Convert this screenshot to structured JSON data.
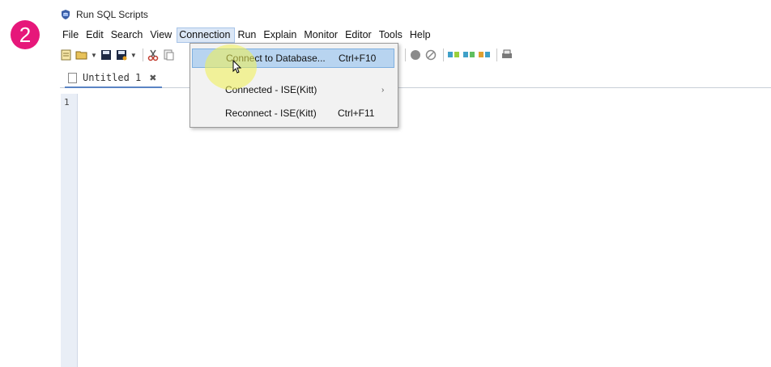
{
  "step": {
    "number": "2",
    "color": "#e6177a"
  },
  "window": {
    "title": "Run SQL Scripts",
    "icon": "database-shield-icon"
  },
  "menubar": {
    "items": [
      {
        "label": "File"
      },
      {
        "label": "Edit"
      },
      {
        "label": "Search"
      },
      {
        "label": "View"
      },
      {
        "label": "Connection",
        "active": true
      },
      {
        "label": "Run"
      },
      {
        "label": "Explain"
      },
      {
        "label": "Monitor"
      },
      {
        "label": "Editor"
      },
      {
        "label": "Tools"
      },
      {
        "label": "Help"
      }
    ]
  },
  "toolbar": {
    "icons": [
      "new-script-icon",
      "open-folder-icon",
      "save-icon",
      "save-as-icon",
      "cut-icon",
      "copy-icon",
      "run-arrow-icon",
      "stop-circle-icon",
      "cancel-icon",
      "visual-explain-icon",
      "explain-icon",
      "run-explain-icon",
      "print-icon"
    ]
  },
  "tabs": [
    {
      "label": "Untitled 1",
      "close": "✖"
    }
  ],
  "editor": {
    "line_numbers": [
      "1"
    ]
  },
  "connection_menu": {
    "items": [
      {
        "label": "Connect to Database...",
        "shortcut": "Ctrl+F10",
        "highlighted": true
      },
      {
        "label": "Connected - ISE(Kitt)",
        "submenu_arrow": "›"
      },
      {
        "label": "Reconnect - ISE(Kitt)",
        "shortcut": "Ctrl+F11"
      }
    ]
  },
  "colors": {
    "accent": "#5a84c4",
    "menu_highlight": "#b8d4f0",
    "cursor_highlight": "#f0f050"
  }
}
